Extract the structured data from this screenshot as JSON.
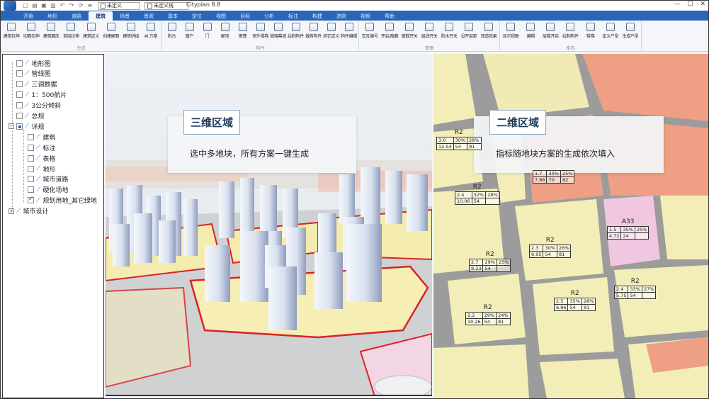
{
  "window": {
    "app_title": "Cityplan 8.8",
    "layer_combo": "未定义",
    "style_combo": "未定义线",
    "controls": [
      "—",
      "☐",
      "✕"
    ]
  },
  "menu": {
    "tabs": [
      "开始",
      "地形",
      "道路",
      "建筑",
      "场景",
      "景观",
      "基本",
      "定位",
      "视图",
      "目标",
      "分析",
      "标注",
      "构建",
      "选则",
      "视频",
      "帮助"
    ],
    "active_tab": "建筑"
  },
  "ribbon": {
    "groups": [
      {
        "label": "生成",
        "buttons": [
          "建筑拉伸",
          "切面拉伸",
          "建筑面库",
          "单层拉伸",
          "建筑定义",
          "创建屋面",
          "建筑拼接",
          "AI 方案"
        ]
      },
      {
        "label": "构件",
        "buttons": [
          "阳台",
          "窗户",
          "门",
          "屋顶",
          "雨篷",
          "室外楼梯",
          "玻璃幕墙",
          "绘制构件",
          "裁剪构件",
          "其它定义",
          "构件编辑"
        ]
      },
      {
        "label": "管理",
        "buttons": [
          "交互编号",
          "开启/隐藏",
          "窗数开关",
          "层线开关",
          "防水开关",
          "设开层距",
          "双道效果"
        ]
      },
      {
        "label": "室内",
        "buttons": [
          "显示视图",
          "编辑",
          "层楼开启",
          "绘制构件",
          "楼梯",
          "定义户型",
          "生成户型"
        ]
      }
    ]
  },
  "tree": {
    "items": [
      {
        "label": "地形图",
        "state": "unchecked",
        "level": 0
      },
      {
        "label": "管线图",
        "state": "unchecked",
        "level": 0
      },
      {
        "label": "三调数据",
        "state": "unchecked",
        "level": 0
      },
      {
        "label": "1：500航片",
        "state": "unchecked",
        "level": 0
      },
      {
        "label": "3公分倾斜",
        "state": "unchecked",
        "level": 0
      },
      {
        "label": "总规",
        "state": "unchecked",
        "level": 0
      },
      {
        "label": "详规",
        "state": "partial",
        "level": 0,
        "expander": "−"
      },
      {
        "label": "建筑",
        "state": "unchecked",
        "level": 1
      },
      {
        "label": "标注",
        "state": "unchecked",
        "level": 1
      },
      {
        "label": "表格",
        "state": "unchecked",
        "level": 1
      },
      {
        "label": "地形",
        "state": "unchecked",
        "level": 1
      },
      {
        "label": "城市道路",
        "state": "unchecked",
        "level": 1
      },
      {
        "label": "硬化场地",
        "state": "unchecked",
        "level": 1
      },
      {
        "label": "规划用地_其它绿地",
        "state": "checked",
        "level": 1
      },
      {
        "label": "城市设计",
        "state": "none",
        "level": 0,
        "expander": "+"
      }
    ]
  },
  "callout_3d": {
    "title": "三维区域",
    "body": "选中多地块，所有方案一键生成"
  },
  "callout_2d": {
    "title": "二维区域",
    "body": "指标随地块方案的生成依次填入"
  },
  "plots": [
    {
      "zone": "R2",
      "row1": [
        "3.0",
        "30%",
        "28%"
      ],
      "row2": [
        "12.54",
        "54",
        "81"
      ]
    },
    {
      "zone": "",
      "row1": [
        "1.7",
        "30%",
        "25%"
      ],
      "row2": [
        "7.86",
        "70",
        "82"
      ]
    },
    {
      "zone": "R2",
      "row1": [
        "2.4",
        "32%",
        "28%"
      ],
      "row2": [
        "10.06",
        "54",
        ""
      ]
    },
    {
      "zone": "A33",
      "row1": [
        "1.5",
        "35%",
        "25%"
      ],
      "row2": [
        "4.72",
        "24",
        ""
      ]
    },
    {
      "zone": "R2",
      "row1": [
        "2.3",
        "30%",
        "26%"
      ],
      "row2": [
        "6.95",
        "54",
        "81"
      ]
    },
    {
      "zone": "R2",
      "row1": [
        "2.7",
        "29%",
        "25%"
      ],
      "row2": [
        "8.23",
        "54",
        ""
      ]
    },
    {
      "zone": "R2",
      "row1": [
        "2.4",
        "33%",
        "27%"
      ],
      "row2": [
        "5.75",
        "54",
        ""
      ]
    },
    {
      "zone": "R2",
      "row1": [
        "2.5",
        "35%",
        "28%"
      ],
      "row2": [
        "6.86",
        "54",
        "81"
      ]
    },
    {
      "zone": "R2",
      "row1": [
        "2.2",
        "29%",
        "24%"
      ],
      "row2": [
        "10.26",
        "54",
        "81"
      ]
    }
  ],
  "colors": {
    "menubar": "#2a66b8",
    "residential": "#f2ecb8",
    "commercial": "#ee9f84",
    "public": "#f0c6e0",
    "road": "#9a9a9a",
    "plot_boundary": "#d8232a"
  }
}
